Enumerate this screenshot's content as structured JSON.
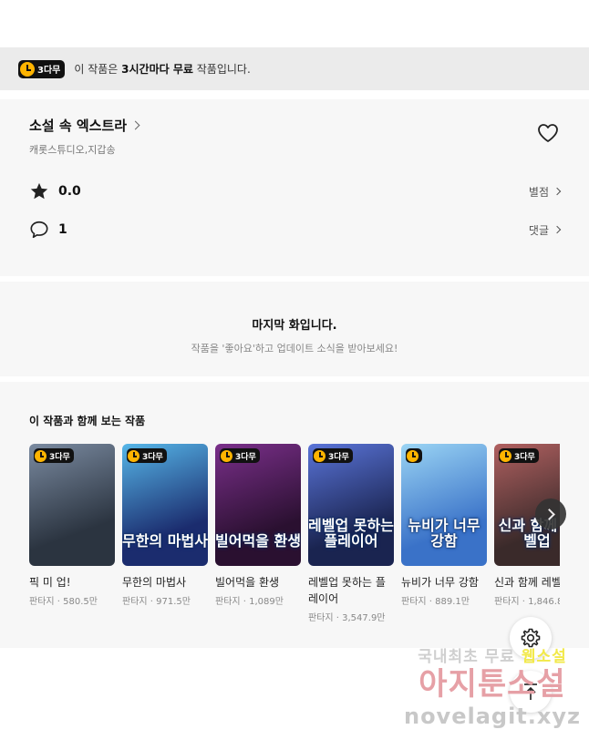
{
  "notice": {
    "badge": "3다무",
    "text_before": "이 작품은 ",
    "text_bold": "3시간마다 무료",
    "text_after": " 작품입니다."
  },
  "work": {
    "title": "소설 속 엑스트라",
    "author": "캐롯스튜디오,지갑송",
    "rating": "0.0",
    "rating_link": "별점",
    "comments": "1",
    "comments_link": "댓글"
  },
  "last_episode": {
    "title": "마지막 화입니다.",
    "subtitle": "작품을 '좋아요'하고 업데이트 소식을 받아보세요!"
  },
  "recommendations": {
    "heading": "이 작품과 함께 보는 작품",
    "items": [
      {
        "badge": "3다무",
        "cover_text": "",
        "name": "픽 미 업!",
        "meta": "판타지 · 580.5만",
        "c1": "#2b3440",
        "c2": "#7a8aa0"
      },
      {
        "badge": "3다무",
        "cover_text": "무한의 마법사",
        "name": "무한의 마법사",
        "meta": "판타지 · 971.5만",
        "c1": "#1b2c6e",
        "c2": "#56b6e8"
      },
      {
        "badge": "3다무",
        "cover_text": "빌어먹을 환생",
        "name": "빌어먹을 환생",
        "meta": "판타지 · 1,089만",
        "c1": "#2a1030",
        "c2": "#7a2f8a"
      },
      {
        "badge": "3다무",
        "cover_text": "레벨업 못하는 플레이어",
        "name": "레벨업 못하는 플레이어",
        "meta": "판타지 · 3,547.9만",
        "c1": "#1a2450",
        "c2": "#5a74d8"
      },
      {
        "badge": "",
        "cover_text": "뉴비가 너무 강함",
        "name": "뉴비가 너무 강함",
        "meta": "판타지 · 889.1만",
        "c1": "#3a72c8",
        "c2": "#9ad4f4"
      },
      {
        "badge": "3다무",
        "cover_text": "신과 함께 레벨업",
        "name": "신과 함께 레벨",
        "meta": "판타지 · 1,846.8",
        "c1": "#3a2a2a",
        "c2": "#b06060"
      }
    ]
  },
  "watermark": {
    "line1a": "국내최초 무료 ",
    "line1b": "웹소설",
    "line2": "아지툰소설",
    "line3": "novelagit.xyz"
  }
}
